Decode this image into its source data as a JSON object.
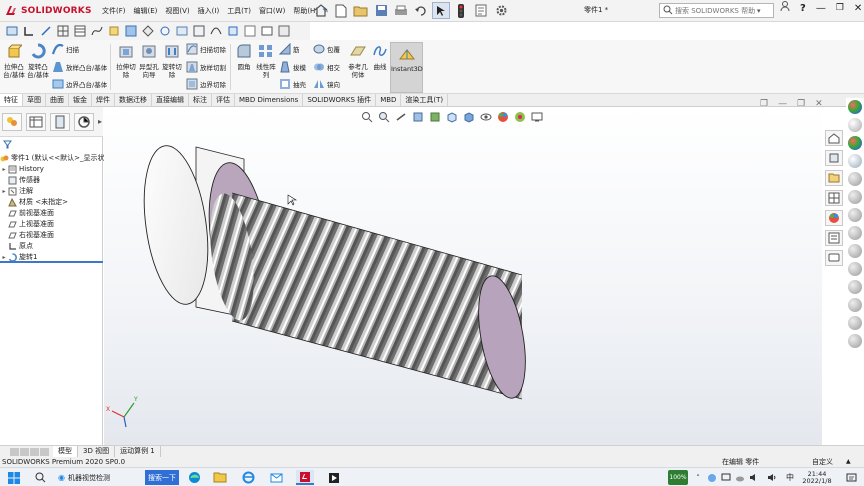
{
  "app": {
    "brand": "SOLIDWORKS",
    "document_title": "零件1 *",
    "search_placeholder": "搜索 SOLIDWORKS 帮助",
    "brand_color": "#c8102e"
  },
  "menus": [
    "文件(F)",
    "编辑(E)",
    "视图(V)",
    "插入(I)",
    "工具(T)",
    "窗口(W)",
    "帮助(H)"
  ],
  "features": {
    "extrude_boss": "拉伸凸台/基体",
    "revolve_boss": "旋转凸台/基体",
    "sweep": "扫描",
    "loft_boss": "放样凸台/基体",
    "boundary_boss": "边界凸台/基体",
    "extrude_cut": "拉伸切除",
    "hole_wizard": "异型孔向导",
    "revolve_cut": "旋转切除",
    "swept_cut": "扫描切除",
    "lofted_cut": "放样切割",
    "boundary_cut": "边界切除",
    "fillet": "圆角",
    "linear_pattern": "线性阵列",
    "rib": "筋",
    "draft": "拔模",
    "shell": "抽壳",
    "wrap": "包覆",
    "intersect": "相交",
    "mirror": "镜向",
    "ref_geometry": "参考几何体",
    "curves": "曲线",
    "instant3d": "Instant3D"
  },
  "tabs": [
    "特征",
    "草图",
    "曲面",
    "钣金",
    "焊件",
    "数据迁移",
    "直接编辑",
    "标注",
    "评估",
    "MBD Dimensions",
    "SOLIDWORKS 插件",
    "MBD",
    "渲染工具(T)"
  ],
  "tree": {
    "root": "零件1 (默认<<默认>_显示状",
    "items": [
      "History",
      "传感器",
      "注解",
      "材质 <未指定>",
      "前视基准面",
      "上视基准面",
      "右视基准面",
      "原点",
      "旋转1"
    ]
  },
  "bottom_tabs": [
    "模型",
    "3D 视图",
    "运动算例 1"
  ],
  "status": {
    "left": "SOLIDWORKS Premium 2020 SP0.0",
    "editing": "在编辑 零件",
    "custom": "自定义"
  },
  "taskbar": {
    "search_label": "机器视觉检测",
    "search_button": "搜索一下",
    "battery": "100%",
    "time": "21:44",
    "date": "2022/1/8",
    "ime": "中"
  },
  "colors": {
    "viewport_top": "#ffffff",
    "viewport_bottom": "#e4e8ee",
    "part_face": "#b9a6bd",
    "accent": "#3b78c7"
  }
}
